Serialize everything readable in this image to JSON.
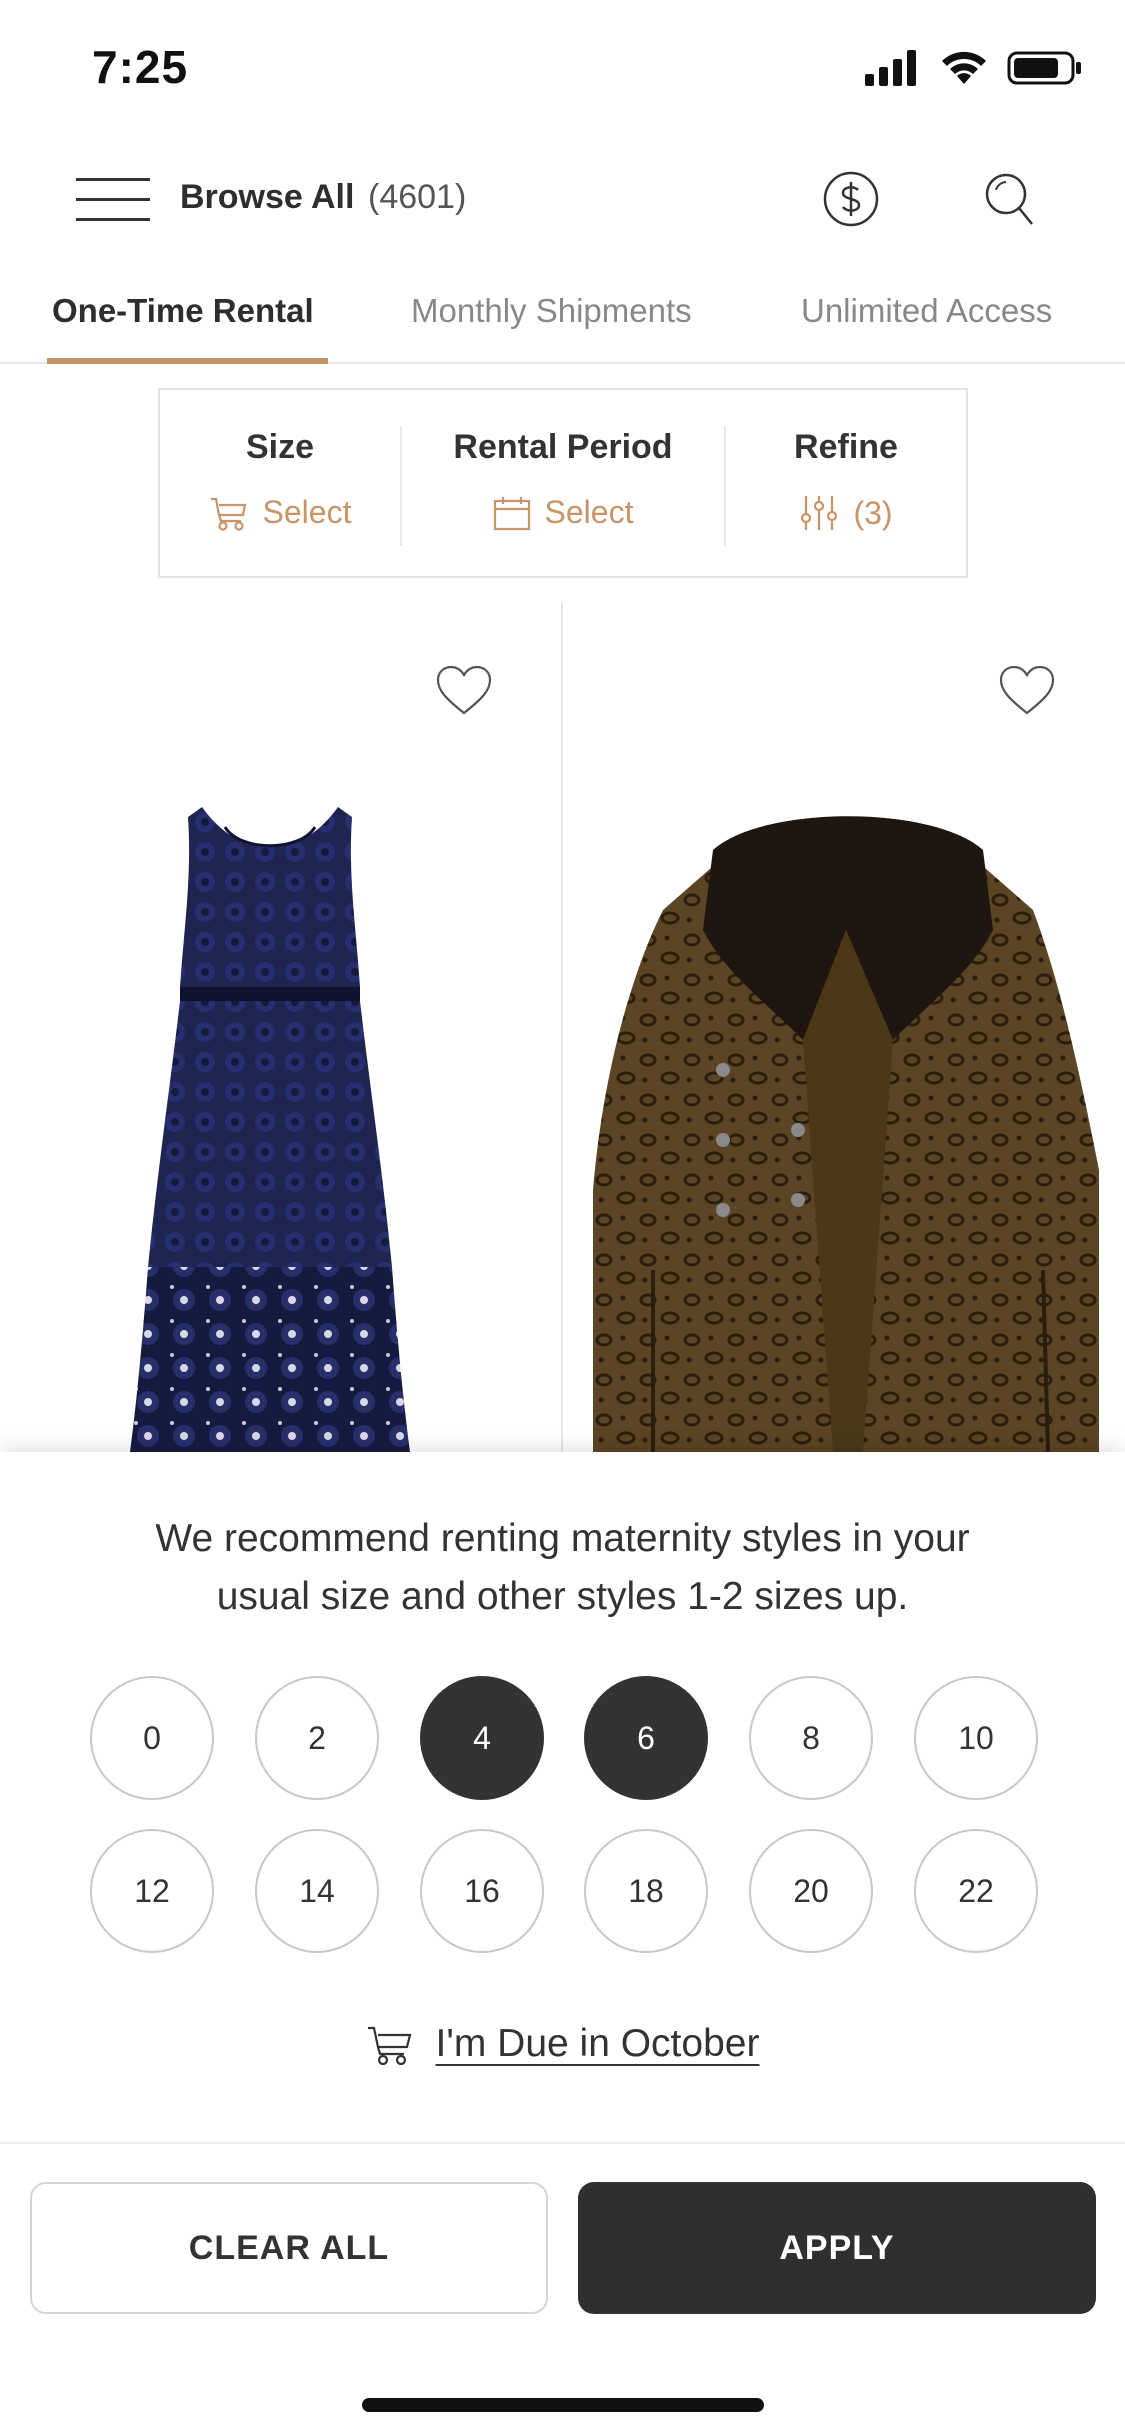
{
  "status_bar": {
    "time": "7:25",
    "icons": [
      "signal-icon",
      "wifi-icon",
      "battery-icon"
    ]
  },
  "header": {
    "title": "Browse All",
    "count": "(4601)",
    "icons": [
      "menu-icon",
      "dollar-icon",
      "search-icon"
    ]
  },
  "tabs": [
    {
      "label": "One-Time Rental",
      "active": true
    },
    {
      "label": "Monthly Shipments",
      "active": false
    },
    {
      "label": "Unlimited Access",
      "active": false
    }
  ],
  "filters": {
    "size": {
      "label": "Size",
      "value": "Select",
      "icon": "stroller-icon"
    },
    "rental_period": {
      "label": "Rental Period",
      "value": "Select",
      "icon": "calendar-icon"
    },
    "refine": {
      "label": "Refine",
      "value": "(3)",
      "icon": "sliders-icon"
    }
  },
  "products": [
    {
      "image": "navy-lace-dress",
      "icon": "heart-icon"
    },
    {
      "image": "leopard-faux-fur-coat",
      "icon": "heart-icon"
    }
  ],
  "size_sheet": {
    "recommend_line1": "We recommend renting maternity styles in your",
    "recommend_line2": "usual size and other styles 1-2 sizes up.",
    "sizes": [
      "0",
      "2",
      "4",
      "6",
      "8",
      "10",
      "12",
      "14",
      "16",
      "18",
      "20",
      "22"
    ],
    "selected": [
      "4",
      "6"
    ],
    "due_text": "I'm Due in October",
    "clear_label": "CLEAR ALL",
    "apply_label": "APPLY"
  },
  "colors": {
    "accent": "#c4936a",
    "dark": "#2f2f2f",
    "border": "#c8c8c8"
  }
}
